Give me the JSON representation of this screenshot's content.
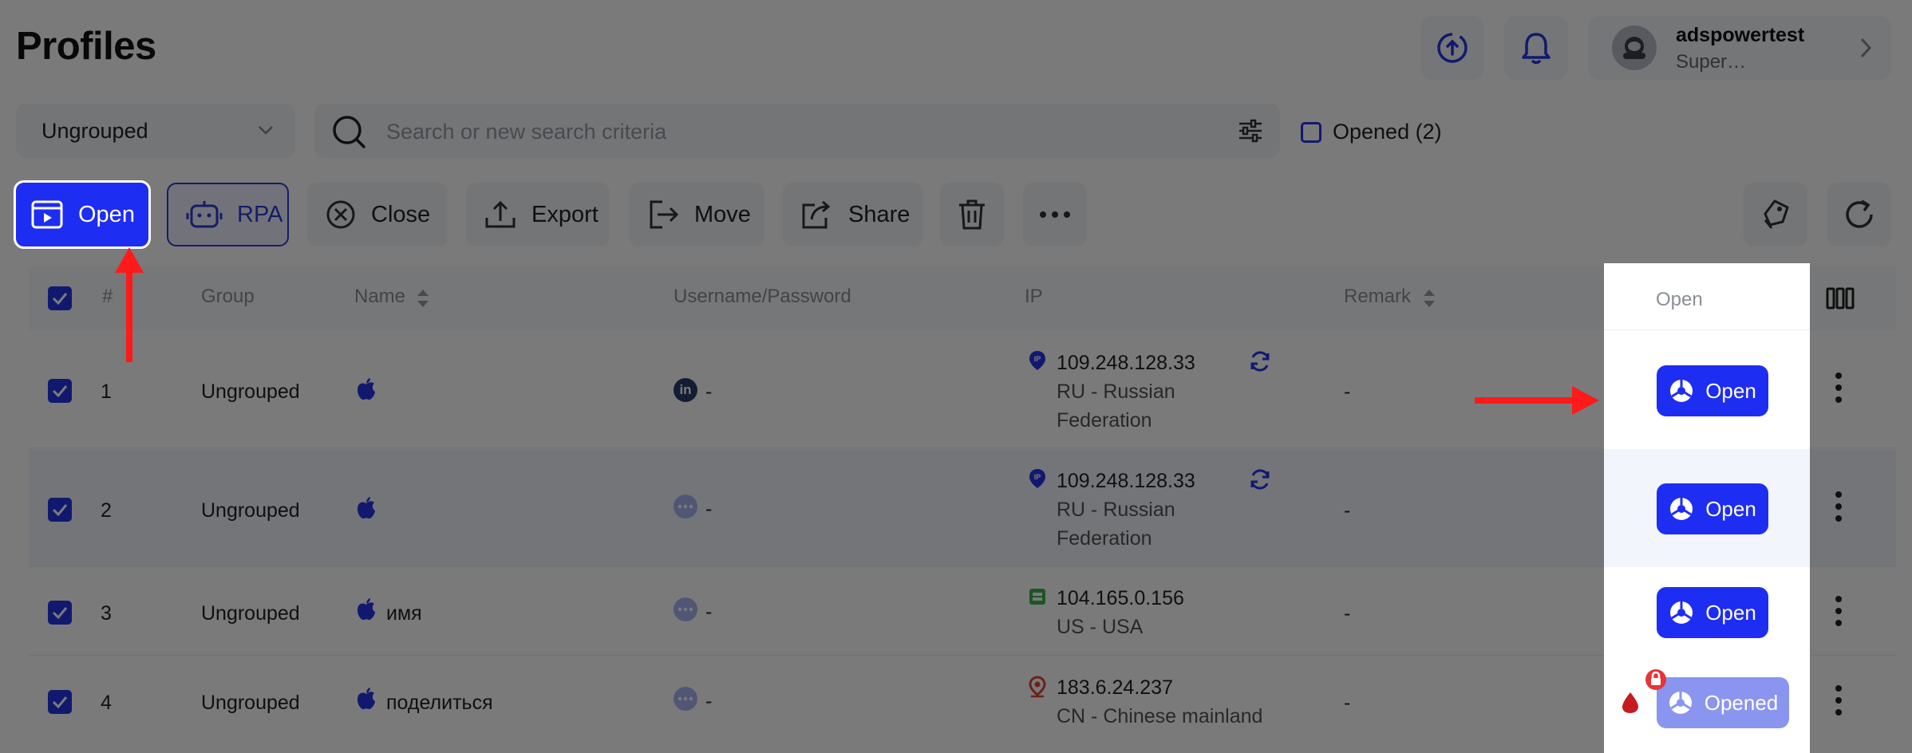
{
  "header": {
    "title": "Profiles",
    "user_name": "adspowertest",
    "user_role": "Super…"
  },
  "filters": {
    "group_value": "Ungrouped",
    "search_placeholder": "Search or new search criteria",
    "opened_label": "Opened (2)"
  },
  "toolbar": {
    "open": "Open",
    "rpa": "RPA",
    "close": "Close",
    "export": "Export",
    "move": "Move",
    "share": "Share"
  },
  "table": {
    "headers": {
      "num": "#",
      "group": "Group",
      "name": "Name",
      "userpass": "Username/Password",
      "ip": "IP",
      "remark": "Remark",
      "open": "Open"
    },
    "rows": [
      {
        "num": "1",
        "group": "Ungrouped",
        "name": "",
        "userpass": "-",
        "ip": "109.248.128.33",
        "location": "RU - Russian Federation",
        "location_1": "RU - Russian",
        "location_2": "Federation",
        "remark": "-",
        "action": "Open"
      },
      {
        "num": "2",
        "group": "Ungrouped",
        "name": "",
        "userpass": "-",
        "ip": "109.248.128.33",
        "location": "RU - Russian Federation",
        "location_1": "RU - Russian",
        "location_2": "Federation",
        "remark": "-",
        "action": "Open"
      },
      {
        "num": "3",
        "group": "Ungrouped",
        "name": "имя",
        "userpass": "-",
        "ip": "104.165.0.156",
        "location": "US - USA",
        "location_1": "US - USA",
        "remark": "-",
        "action": "Open"
      },
      {
        "num": "4",
        "group": "Ungrouped",
        "name": "поделиться",
        "userpass": "-",
        "ip": "183.6.24.237",
        "location": "CN - Chinese mainland",
        "location_1": "CN - Chinese mainland",
        "remark": "-",
        "action": "Opened"
      }
    ],
    "linkedin_badge": "in"
  },
  "colors": {
    "accent": "#1e2df2",
    "annotation_arrow": "#ff1a1a",
    "overlay": "rgba(0,0,0,0.52)"
  }
}
